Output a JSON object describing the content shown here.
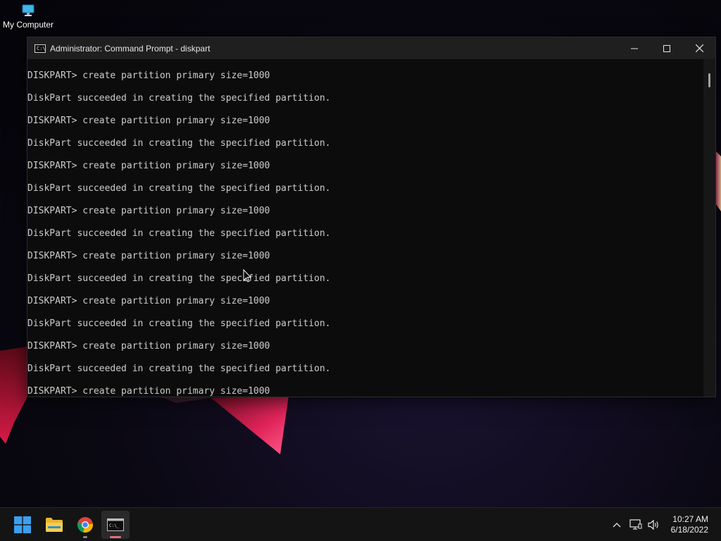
{
  "desktop": {
    "icons": [
      {
        "label": "My Computer",
        "icon": "monitor-icon"
      }
    ]
  },
  "window": {
    "title": "Administrator: Command Prompt - diskpart",
    "app_icon": "cmd-icon",
    "controls": {
      "minimize": "minimize-icon",
      "maximize": "maximize-icon",
      "close": "close-icon"
    }
  },
  "console": {
    "lines": [
      "DISKPART> create partition primary size=1000",
      "DiskPart succeeded in creating the specified partition.",
      "DISKPART> create partition primary size=1000",
      "DiskPart succeeded in creating the specified partition.",
      "DISKPART> create partition primary size=1000",
      "DiskPart succeeded in creating the specified partition.",
      "DISKPART> create partition primary size=1000",
      "DiskPart succeeded in creating the specified partition.",
      "DISKPART> create partition primary size=1000",
      "DiskPart succeeded in creating the specified partition.",
      "DISKPART> create partition primary size=1000",
      "DiskPart succeeded in creating the specified partition.",
      "DISKPART> create partition primary size=1000",
      "DiskPart succeeded in creating the specified partition.",
      "DISKPART> create partition primary size=1000"
    ]
  },
  "taskbar": {
    "apps": [
      {
        "name": "start",
        "icon": "windows-start-icon"
      },
      {
        "name": "file-explorer",
        "icon": "folder-icon"
      },
      {
        "name": "chrome",
        "icon": "chrome-icon"
      },
      {
        "name": "command-prompt",
        "icon": "terminal-icon"
      }
    ],
    "tray": {
      "chevron": "chevron-up-icon",
      "network": "network-icon",
      "volume": "volume-icon"
    },
    "clock": {
      "time": "10:27 AM",
      "date": "6/18/2022"
    }
  },
  "colors": {
    "console_bg": "#0c0c0c",
    "console_text": "#cccccc",
    "titlebar_bg": "#1f1f1f",
    "taskbar_bg": "#141414",
    "active_indicator": "#e0707a"
  }
}
